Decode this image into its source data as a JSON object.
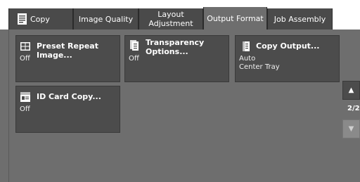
{
  "tabs": [
    {
      "label": "Copy",
      "icon": "copy-icon"
    },
    {
      "label": "Image Quality"
    },
    {
      "label": "Layout\nAdjustment"
    },
    {
      "label": "Output Format",
      "active": true
    },
    {
      "label": "Job Assembly"
    }
  ],
  "cards": {
    "preset_repeat": {
      "title": "Preset Repeat Image...",
      "value": "Off",
      "icon": "preset-repeat-icon"
    },
    "transparency": {
      "title": "Transparency\nOptions...",
      "value": "Off",
      "icon": "transparency-icon"
    },
    "copy_output": {
      "title": "Copy Output...",
      "value": "Auto\nCenter Tray",
      "icon": "copy-output-icon"
    },
    "id_card": {
      "title": "ID Card Copy...",
      "value": "Off",
      "icon": "id-card-icon"
    }
  },
  "pager": {
    "indicator": "2/2",
    "up_icon": "arrow-up-icon",
    "down_icon": "arrow-down-icon"
  }
}
